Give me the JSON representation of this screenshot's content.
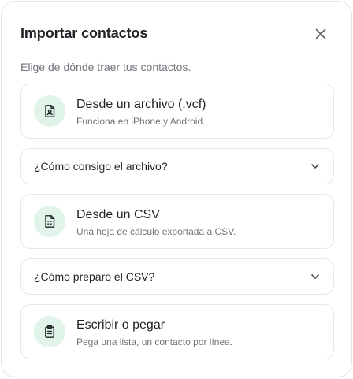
{
  "dialog": {
    "title": "Importar contactos",
    "subtitle": "Elige de dónde traer tus contactos.",
    "close_icon": "close-icon"
  },
  "options": [
    {
      "title": "Desde un archivo (.vcf)",
      "description": "Funciona en iPhone y Android.",
      "icon": "contact-file-icon"
    },
    {
      "title": "Desde un CSV",
      "description": "Una hoja de cálculo exportada a CSV.",
      "icon": "spreadsheet-file-icon"
    },
    {
      "title": "Escribir o pegar",
      "description": "Pega una lista, un contacto por línea.",
      "icon": "clipboard-icon"
    }
  ],
  "accordions": [
    {
      "label": "¿Cómo consigo el archivo?",
      "icon": "chevron-down-icon"
    },
    {
      "label": "¿Cómo preparo el CSV?",
      "icon": "chevron-down-icon"
    }
  ],
  "colors": {
    "accent": "#1f8a55",
    "icon_bg": "#e0f4e9",
    "border": "#e6e8eb",
    "muted_text": "#70757b"
  }
}
